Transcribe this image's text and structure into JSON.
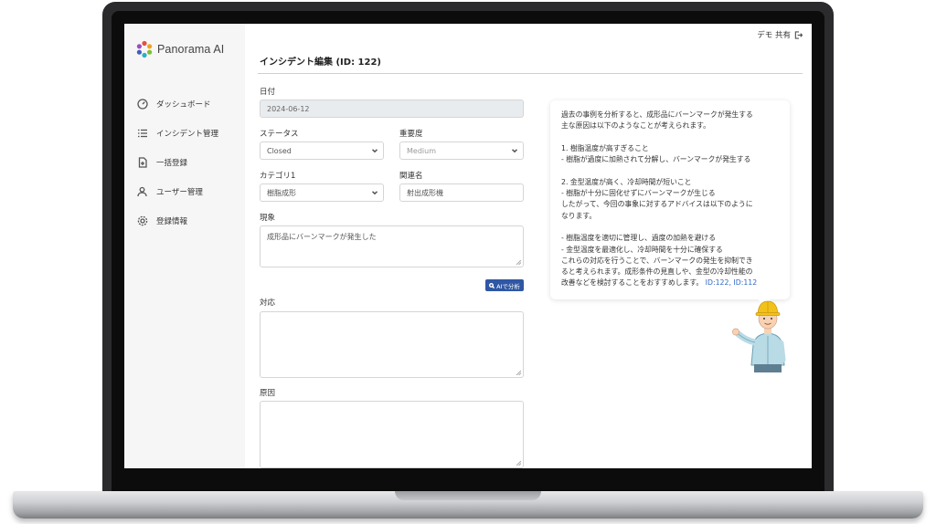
{
  "app": {
    "name": "Panorama AI"
  },
  "header": {
    "share_label": "デモ 共有"
  },
  "sidebar": {
    "items": [
      {
        "label": "ダッシュボード",
        "icon": "gauge-icon"
      },
      {
        "label": "インシデント管理",
        "icon": "list-icon"
      },
      {
        "label": "一括登録",
        "icon": "file-plus-icon"
      },
      {
        "label": "ユーザー管理",
        "icon": "user-icon"
      },
      {
        "label": "登録情報",
        "icon": "gear-icon"
      }
    ]
  },
  "page": {
    "title": "インシデント編集 (ID: 122)"
  },
  "form": {
    "date": {
      "label": "日付",
      "value": "2024-06-12"
    },
    "status": {
      "label": "ステータス",
      "value": "Closed"
    },
    "severity": {
      "label": "重要度",
      "value": "Medium"
    },
    "category1": {
      "label": "カテゴリ1",
      "value": "樹脂成形"
    },
    "related": {
      "label": "関連名",
      "value": "射出成形機"
    },
    "phenomenon": {
      "label": "現象",
      "value": "成形品にバーンマークが発生した"
    },
    "ai_button": "AIで分析",
    "response": {
      "label": "対応",
      "value": ""
    },
    "cause": {
      "label": "原因",
      "value": ""
    }
  },
  "advice": {
    "lines": [
      "過去の事例を分析すると、成形品にバーンマークが発生する",
      "主な原因は以下のようなことが考えられます。",
      "",
      "1. 樹脂温度が高すぎること",
      "- 樹脂が過度に加熱されて分解し、バーンマークが発生する",
      "",
      "2. 金型温度が高く、冷却時間が短いこと",
      "- 樹脂が十分に固化せずにバーンマークが生じる",
      "したがって、今回の事象に対するアドバイスは以下のように",
      "なります。",
      "",
      "- 樹脂温度を適切に管理し、過度の加熱を避ける",
      "- 金型温度を最適化し、冷却時間を十分に確保する",
      "これらの対応を行うことで、バーンマークの発生を抑制でき",
      "ると考えられます。成形条件の見直しや、金型の冷却性能の"
    ],
    "last_line": "改善などを検討することをおすすめします。",
    "refs": "ID:122, ID:112"
  },
  "colors": {
    "accent": "#2f57a3",
    "link": "#2f67c9",
    "sidebar_bg": "#f6f6f6"
  }
}
